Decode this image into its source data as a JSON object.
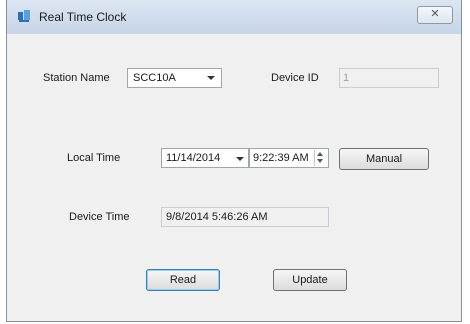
{
  "window": {
    "title": "Real Time Clock",
    "close_glyph": "✕"
  },
  "station": {
    "label": "Station Name",
    "selected": "SCC10A"
  },
  "device_id": {
    "label": "Device ID",
    "value": "1"
  },
  "local_time": {
    "label": "Local Time",
    "date": "11/14/2014",
    "time": "9:22:39 AM"
  },
  "manual_button": "Manual",
  "device_time": {
    "label": "Device Time",
    "value": "9/8/2014 5:46:26 AM"
  },
  "read_button": "Read",
  "update_button": "Update"
}
